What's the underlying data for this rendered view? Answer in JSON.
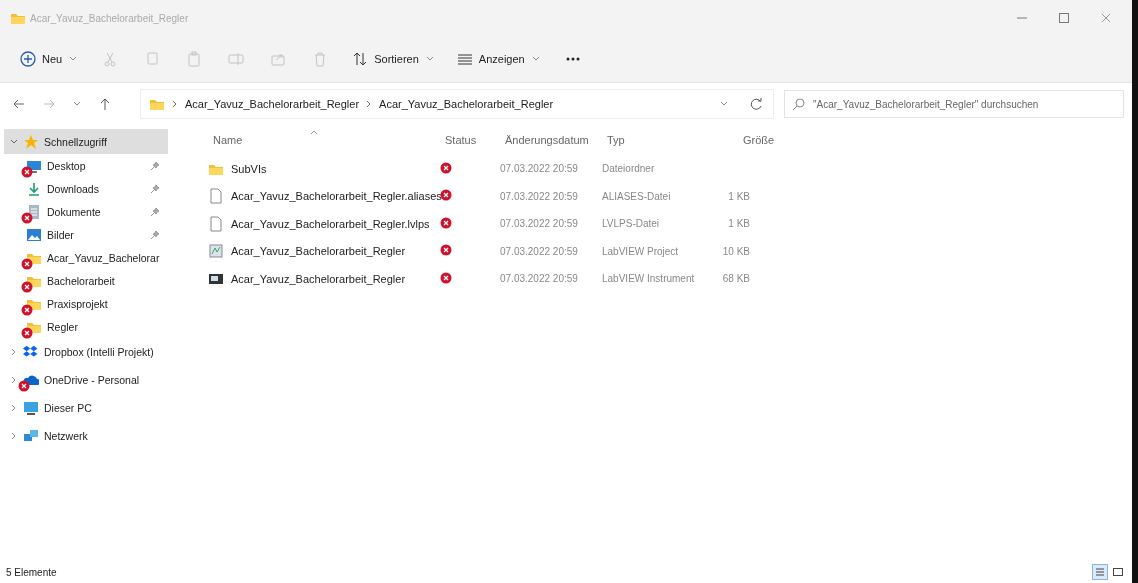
{
  "window": {
    "title": "Acar_Yavuz_Bachelorarbeit_Regler"
  },
  "toolbar": {
    "new": {
      "label": "Neu"
    },
    "actions": [
      {
        "kind": "cut",
        "disabled": true
      },
      {
        "kind": "copy",
        "disabled": true
      },
      {
        "kind": "paste",
        "disabled": true
      },
      {
        "kind": "rename",
        "disabled": true
      },
      {
        "kind": "share",
        "disabled": true
      },
      {
        "kind": "delete",
        "disabled": true
      }
    ],
    "sort": {
      "label": "Sortieren"
    },
    "view": {
      "label": "Anzeigen"
    }
  },
  "address_bar": {
    "path": [
      "Acar_Yavuz_Bachelorarbeit_Regler",
      "Acar_Yavuz_Bachelorarbeit_Regler"
    ],
    "search": {
      "placeholder": "\"Acar_Yavuz_Bachelorarbeit_Regler\" durchsuchen"
    }
  },
  "sidebar": {
    "items": [
      {
        "label": "Schnellzugriff",
        "kind": "star",
        "expanded": true,
        "selected": true,
        "children": [
          {
            "label": "Desktop",
            "kind": "desktop",
            "pinned": true,
            "sync_error": true,
            "selected": false
          },
          {
            "label": "Downloads",
            "kind": "download",
            "pinned": true,
            "sync_error": false,
            "selected": false
          },
          {
            "label": "Dokumente",
            "kind": "documents",
            "pinned": true,
            "sync_error": true,
            "selected": false
          },
          {
            "label": "Bilder",
            "kind": "pictures",
            "pinned": true,
            "sync_error": false,
            "selected": false
          },
          {
            "label": "Acar_Yavuz_Bachelorar",
            "kind": "folder",
            "pinned": false,
            "sync_error": true,
            "selected": false
          },
          {
            "label": "Bachelorarbeit",
            "kind": "folder",
            "pinned": false,
            "sync_error": true,
            "selected": false
          },
          {
            "label": "Praxisprojekt",
            "kind": "folder",
            "pinned": false,
            "sync_error": true,
            "selected": false
          },
          {
            "label": "Regler",
            "kind": "folder",
            "pinned": false,
            "sync_error": true,
            "selected": false
          }
        ]
      },
      {
        "label": "Dropbox (Intelli Projekt)",
        "kind": "dropbox",
        "expanded": false,
        "selected": false,
        "sync_error": false
      },
      {
        "label": "OneDrive - Personal",
        "kind": "onedrive",
        "expanded": false,
        "selected": false,
        "sync_error": true
      },
      {
        "label": "Dieser PC",
        "kind": "pc",
        "expanded": false,
        "selected": false,
        "sync_error": false
      },
      {
        "label": "Netzwerk",
        "kind": "network",
        "expanded": false,
        "selected": false,
        "sync_error": false
      }
    ]
  },
  "table": {
    "columns": [
      "Name",
      "Status",
      "Änderungsdatum",
      "Typ",
      "Größe"
    ],
    "rows": [
      {
        "name": "SubVIs",
        "kind": "folder",
        "status_error": true,
        "date": "07.03.2022 20:59",
        "type": "Dateiordner"
      },
      {
        "name": "Acar_Yavuz_Bachelorarbeit_Regler.aliases",
        "kind": "file",
        "status_error": true,
        "date": "07.03.2022 20:59",
        "type": "ALIASES-Datei",
        "size": "1 KB"
      },
      {
        "name": "Acar_Yavuz_Bachelorarbeit_Regler.lvlps",
        "kind": "file",
        "status_error": true,
        "date": "07.03.2022 20:59",
        "type": "LVLPS-Datei",
        "size": "1 KB"
      },
      {
        "name": "Acar_Yavuz_Bachelorarbeit_Regler",
        "kind": "project",
        "status_error": true,
        "date": "07.03.2022 20:59",
        "type": "LabVIEW Project",
        "size": "10 KB"
      },
      {
        "name": "Acar_Yavuz_Bachelorarbeit_Regler",
        "kind": "instrument",
        "status_error": true,
        "date": "07.03.2022 20:59",
        "type": "LabVIEW Instrument",
        "size": "68 KB"
      }
    ]
  },
  "status_bar": {
    "count": "5 Elemente",
    "views": [
      {
        "kind": "details",
        "selected": true
      },
      {
        "kind": "tiles",
        "selected": false
      }
    ]
  }
}
